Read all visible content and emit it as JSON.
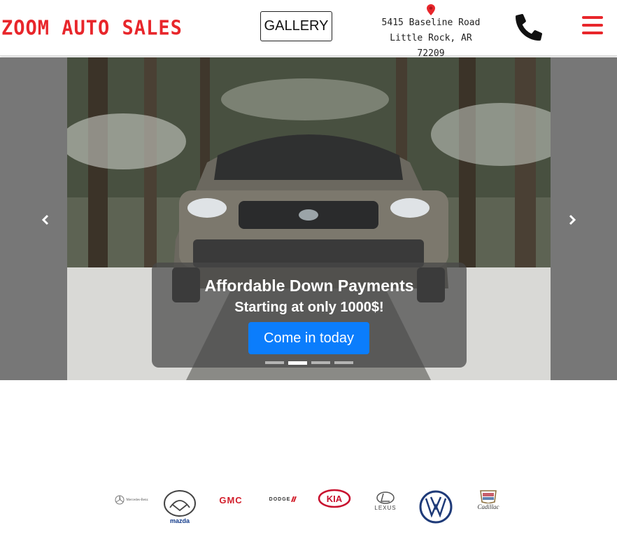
{
  "header": {
    "logo_text": "ZOOM AUTO SALES",
    "gallery_label": "GALLERY",
    "address_line1": "5415 Baseline Road",
    "address_line2": "Little Rock, AR 72209",
    "phone_icon": "phone-icon",
    "menu_icon": "hamburger-menu-icon",
    "pin_icon": "map-pin-icon"
  },
  "carousel": {
    "prev_label": "Previous",
    "next_label": "Next",
    "title": "Affordable Down Payments",
    "subtitle": "Starting at only 1000$!",
    "cta_label": "Come in today",
    "active_slide": 2,
    "slide_count": 4
  },
  "brands": [
    {
      "name": "Mercedes-Benz",
      "label": "Mercedes-Benz"
    },
    {
      "name": "Mazda",
      "label": "mazda"
    },
    {
      "name": "GMC",
      "label": "GMC"
    },
    {
      "name": "Dodge",
      "label": "DODGE"
    },
    {
      "name": "Kia",
      "label": "KIA"
    },
    {
      "name": "Lexus",
      "label": "LEXUS"
    },
    {
      "name": "Volkswagen",
      "label": "VW"
    },
    {
      "name": "Cadillac",
      "label": "Cadillac"
    }
  ],
  "colors": {
    "brand_red": "#e8262b",
    "cta_blue": "#0b7dfc"
  }
}
